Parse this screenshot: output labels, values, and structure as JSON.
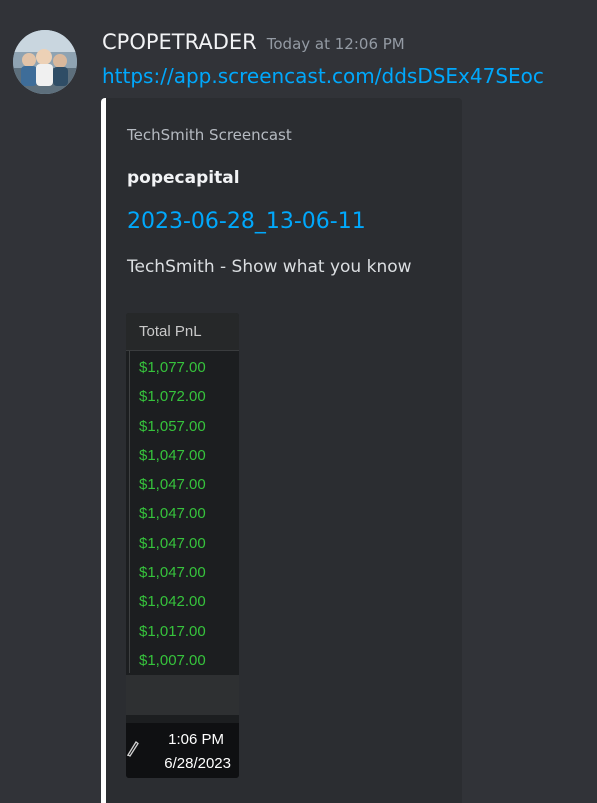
{
  "message": {
    "username": "CPOPETRADER",
    "timestamp": "Today at 12:06 PM",
    "link": "https://app.screencast.com/ddsDSEx47SEoc"
  },
  "embed": {
    "provider": "TechSmith Screencast",
    "author": "popecapital",
    "title": "2023-06-28_13-06-11",
    "description": "TechSmith - Show what you know",
    "accent_color": "#ffffff",
    "image": {
      "column_header": "Total PnL",
      "pnl_values": [
        "$1,077.00",
        "$1,072.00",
        "$1,057.00",
        "$1,047.00",
        "$1,047.00",
        "$1,047.00",
        "$1,047.00",
        "$1,047.00",
        "$1,042.00",
        "$1,017.00",
        "$1,007.00"
      ],
      "value_color": "#36c33c",
      "clock_time": "1:06 PM",
      "clock_date": "6/28/2023",
      "taskbar_icon": "pen-icon"
    }
  },
  "colors": {
    "background": "#313338",
    "embed_background": "#2b2d31",
    "link": "#00a8fc"
  }
}
